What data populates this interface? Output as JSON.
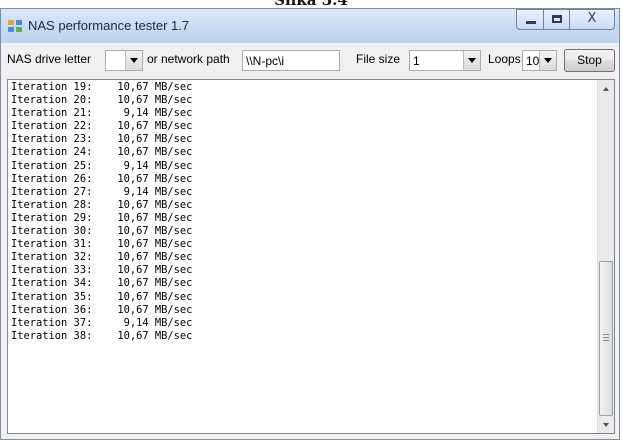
{
  "caption": "Slika 3.4",
  "window": {
    "title": "NAS performance tester 1.7",
    "close_glyph": "X"
  },
  "toolbar": {
    "drive_letter_label": "NAS drive letter",
    "drive_letter_value": "",
    "network_path_label": "or network path",
    "network_path_value": "\\\\N-pc\\i",
    "file_size_label": "File size",
    "file_size_value": "1",
    "loops_label": "Loops",
    "loops_value": "10(",
    "stop_label": "Stop"
  },
  "output": {
    "lines": [
      "Iteration 19:    10,67 MB/sec",
      "Iteration 20:    10,67 MB/sec",
      "Iteration 21:     9,14 MB/sec",
      "Iteration 22:    10,67 MB/sec",
      "Iteration 23:    10,67 MB/sec",
      "Iteration 24:    10,67 MB/sec",
      "Iteration 25:     9,14 MB/sec",
      "Iteration 26:    10,67 MB/sec",
      "Iteration 27:     9,14 MB/sec",
      "Iteration 28:    10,67 MB/sec",
      "Iteration 29:    10,67 MB/sec",
      "Iteration 30:    10,67 MB/sec",
      "Iteration 31:    10,67 MB/sec",
      "Iteration 32:    10,67 MB/sec",
      "Iteration 33:    10,67 MB/sec",
      "Iteration 34:    10,67 MB/sec",
      "Iteration 35:    10,67 MB/sec",
      "Iteration 36:    10,67 MB/sec",
      "Iteration 37:     9,14 MB/sec",
      "Iteration 38:    10,67 MB/sec"
    ]
  },
  "icons": {
    "app": "app-window-icon",
    "minimize": "minimize-icon",
    "maximize": "maximize-icon",
    "close": "close-icon",
    "dropdown": "chevron-down-icon",
    "scroll_up": "scroll-up-arrow-icon",
    "scroll_down": "scroll-down-arrow-icon"
  },
  "colors": {
    "titlebar": "#c5daf1",
    "window_background": "#f0f0f0",
    "output_background": "#ffffff"
  }
}
